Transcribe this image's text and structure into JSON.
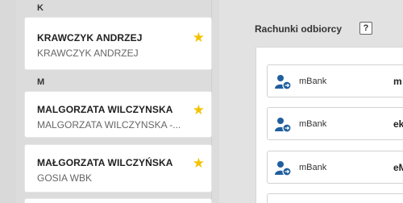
{
  "contacts": {
    "groups": [
      {
        "letter": "K",
        "items": [
          {
            "name": "KRAWCZYK ANDRZEJ",
            "subtitle": "KRAWCZYK ANDRZEJ",
            "favorite": true
          }
        ]
      },
      {
        "letter": "M",
        "items": [
          {
            "name": "MALGORZATA WILCZYNSKA",
            "subtitle": "MALGORZATA WILCZYNSKA -...",
            "favorite": true
          },
          {
            "name": "MAŁGORZATA WILCZYŃSKA",
            "subtitle": "GOSIA WBK",
            "favorite": true
          }
        ]
      }
    ]
  },
  "recipient_accounts": {
    "title": "Rachunki odbiorcy",
    "help_label": "?",
    "accounts": [
      {
        "bank": "mBank",
        "number_fragment": "m"
      },
      {
        "bank": "mBank",
        "number_fragment": "ek"
      },
      {
        "bank": "mBank",
        "number_fragment": "eM"
      }
    ]
  },
  "icons": {
    "favorite": "star-icon",
    "account": "user-account-icon"
  },
  "colors": {
    "star": "#f3c300",
    "account_icon": "#1f5f9e"
  }
}
